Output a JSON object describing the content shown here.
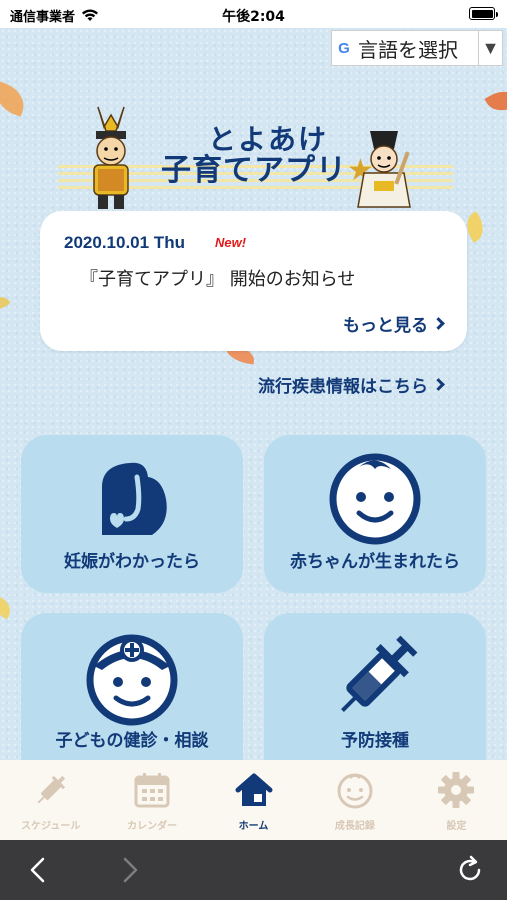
{
  "status_bar": {
    "carrier": "通信事業者",
    "time": "午後2:04"
  },
  "language": {
    "label": "言語を選択",
    "arrow": "▼",
    "brand_letter": "G"
  },
  "logo": {
    "line1": "とよあけ",
    "line2": "子育てアプリ",
    "star": "★"
  },
  "news": {
    "date": "2020.10.01 Thu",
    "badge": "New!",
    "title": "『子育てアプリ』 開始のお知らせ",
    "more_label": "もっと見る"
  },
  "disease_link": {
    "label": "流行疾患情報はこちら"
  },
  "tiles": [
    {
      "label": "妊娠がわかったら",
      "icon": "pregnancy-icon"
    },
    {
      "label": "赤ちゃんが生まれたら",
      "icon": "baby-face-icon"
    },
    {
      "label": "子どもの健診・相談",
      "icon": "checkup-icon"
    },
    {
      "label": "予防接種",
      "icon": "syringe-icon"
    }
  ],
  "tab_bar": [
    {
      "label": "スケジュール",
      "icon": "syringe-icon",
      "active": false
    },
    {
      "label": "カレンダー",
      "icon": "calendar-icon",
      "active": false
    },
    {
      "label": "ホーム",
      "icon": "home-icon",
      "active": true
    },
    {
      "label": "成長記録",
      "icon": "baby-face-icon",
      "active": false
    },
    {
      "label": "設定",
      "icon": "gear-icon",
      "active": false
    }
  ],
  "colors": {
    "brand_navy": "#123a78",
    "tile_blue": "#b9dcef",
    "background": "#d3e6f2",
    "new_red": "#e01b1b",
    "tab_inactive": "#d8c9b6"
  }
}
